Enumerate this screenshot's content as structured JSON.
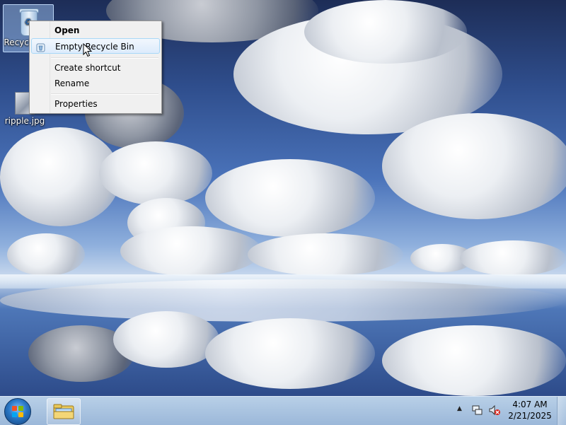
{
  "desktop": {
    "icons": [
      {
        "label": "Recycle Bin",
        "icon": "recycle-bin-icon",
        "selected": true
      },
      {
        "label": "ripple.jpg",
        "icon": "image-file-icon",
        "selected": false
      }
    ]
  },
  "context_menu": {
    "items": [
      {
        "label": "Open",
        "bold": true
      },
      {
        "label": "Empty Recycle Bin",
        "highlighted": true,
        "icon": "shield-icon"
      },
      {
        "label": "Create shortcut"
      },
      {
        "label": "Rename"
      },
      {
        "label": "Properties"
      }
    ]
  },
  "taskbar": {
    "start_icon": "windows-logo-icon",
    "pinned": [
      {
        "name": "Windows Explorer",
        "icon": "folder-icon"
      }
    ],
    "tray": {
      "show_hidden_icon": "chevron-up-icon",
      "network_icon": "network-icon",
      "volume_icon": "volume-muted-icon"
    },
    "clock": {
      "time": "4:07 AM",
      "date": "2/21/2025"
    }
  },
  "colors": {
    "menu_highlight": "#dcebfc",
    "taskbar": "#a9c4e2"
  }
}
